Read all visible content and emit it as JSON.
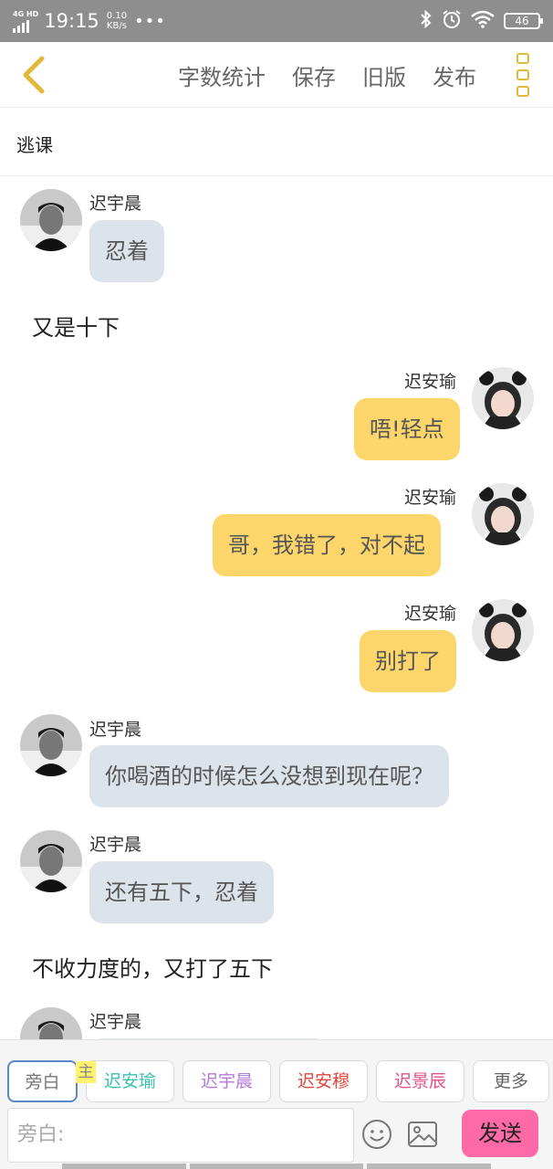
{
  "status_bar": {
    "network": "4G HD",
    "time": "19:15",
    "speed_value": "0.10",
    "speed_unit": "KB/s",
    "dots": "•••",
    "battery": "46"
  },
  "top_bar": {
    "actions": [
      "字数统计",
      "保存",
      "旧版",
      "发布"
    ]
  },
  "title": "逃课",
  "messages": [
    {
      "type": "left",
      "name": "迟宇晨",
      "text": "忍着"
    },
    {
      "type": "narration",
      "text": "又是十下"
    },
    {
      "type": "right",
      "name": "迟安瑜",
      "text": "唔!轻点"
    },
    {
      "type": "right",
      "name": "迟安瑜",
      "text": "哥，我错了，对不起"
    },
    {
      "type": "right",
      "name": "迟安瑜",
      "text": "别打了"
    },
    {
      "type": "left",
      "name": "迟宇晨",
      "text": "你喝酒的时候怎么没想到现在呢？"
    },
    {
      "type": "left",
      "name": "迟宇晨",
      "text": "还有五下，忍着"
    },
    {
      "type": "narration",
      "text": "不收力度的，又打了五下"
    },
    {
      "type": "left",
      "name": "迟宇晨",
      "text": ""
    }
  ],
  "roles": [
    {
      "label": "旁白",
      "color": "#777777"
    },
    {
      "label": "迟安瑜",
      "color": "#3bbfb0"
    },
    {
      "label": "迟宇晨",
      "color": "#b37ad8"
    },
    {
      "label": "迟安穆",
      "color": "#e0463c"
    },
    {
      "label": "迟景辰",
      "color": "#e0528a"
    },
    {
      "label": "更多",
      "color": "#666666"
    }
  ],
  "host_tag": "主",
  "input": {
    "placeholder": "旁白:"
  },
  "send_label": "发送",
  "colors": {
    "accent": "#e0b93a",
    "left_bubble": "#dde3ea",
    "right_bubble": "#fdd66b",
    "send": "#ff6aa6"
  }
}
